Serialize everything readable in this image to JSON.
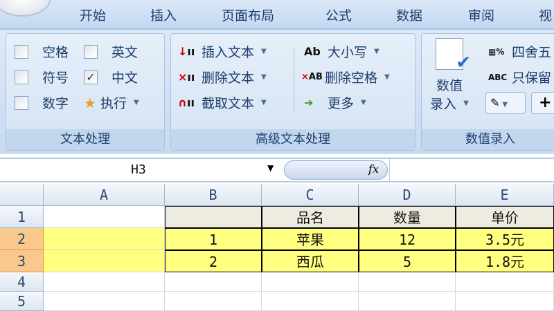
{
  "tabs": [
    "开始",
    "插入",
    "页面布局",
    "公式",
    "数据",
    "审阅",
    "视"
  ],
  "groups": {
    "text": {
      "label": "文本处理",
      "items": [
        {
          "label": "空格",
          "checked": false
        },
        {
          "label": "英文",
          "checked": false
        },
        {
          "label": "符号",
          "checked": false
        },
        {
          "label": "中文",
          "checked": true
        },
        {
          "label": "数字",
          "checked": false
        }
      ],
      "execute": "执行"
    },
    "advanced": {
      "label": "高级文本处理",
      "insert": "插入文本",
      "delete": "删除文本",
      "extract": "截取文本",
      "case": "大小写",
      "case_icon": "Ab",
      "remove_space": "删除空格",
      "remove_icon": "AB",
      "more": "更多"
    },
    "numeric": {
      "label": "数值录入",
      "entry_line1": "数值",
      "entry_line2": "录入",
      "round": "四舍五",
      "keep": "只保留",
      "keep_icon": "ABC",
      "plus": "+"
    }
  },
  "formula_bar": {
    "name_box": "H3",
    "fx": "fx",
    "value": ""
  },
  "columns": [
    "A",
    "B",
    "C",
    "D",
    "E"
  ],
  "rows": [
    {
      "n": "1",
      "cells": [
        "",
        "",
        "品名",
        "数量",
        "单价"
      ]
    },
    {
      "n": "2",
      "cells": [
        "",
        "1",
        "苹果",
        "12",
        "3.5元"
      ]
    },
    {
      "n": "3",
      "cells": [
        "",
        "2",
        "西瓜",
        "5",
        "1.8元"
      ]
    },
    {
      "n": "4",
      "cells": [
        "",
        "",
        "",
        "",
        ""
      ]
    },
    {
      "n": "5",
      "cells": [
        "",
        "",
        "",
        "",
        ""
      ]
    }
  ]
}
